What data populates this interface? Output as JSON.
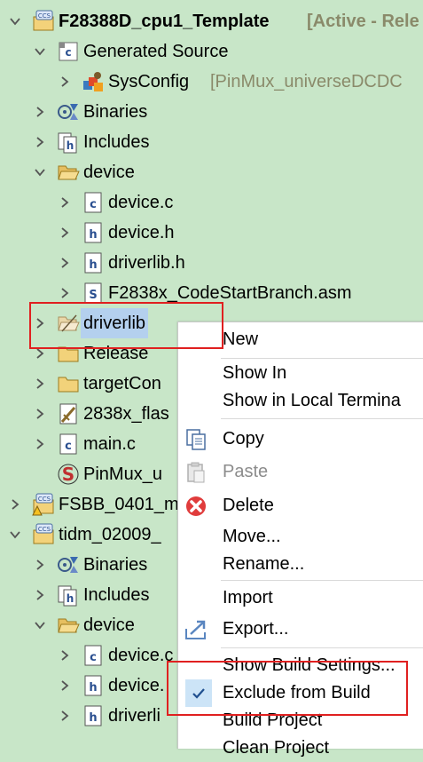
{
  "tree": [
    {
      "label": "F28388D_cpu1_Template",
      "deco": "[Active - Rele",
      "arrow": "down",
      "icon": "ccs-project-icon",
      "bold": true
    },
    {
      "label": "Generated Source",
      "arrow": "down",
      "icon": "source-folder-icon"
    },
    {
      "label": "SysConfig",
      "deco": "[PinMux_universeDCDC",
      "arrow": "right",
      "icon": "sysconfig-icon"
    },
    {
      "label": "Binaries",
      "arrow": "right",
      "icon": "binaries-icon"
    },
    {
      "label": "Includes",
      "arrow": "right",
      "icon": "includes-icon"
    },
    {
      "label": "device",
      "arrow": "down",
      "icon": "folder-open-icon"
    },
    {
      "label": "device.c",
      "arrow": "right",
      "icon": "c-file-icon"
    },
    {
      "label": "device.h",
      "arrow": "right",
      "icon": "h-file-icon"
    },
    {
      "label": "driverlib.h",
      "arrow": "right",
      "icon": "h-file-icon"
    },
    {
      "label": "F2838x_CodeStartBranch.asm",
      "arrow": "right",
      "icon": "asm-file-icon"
    },
    {
      "label": "driverlib",
      "arrow": "right",
      "icon": "excluded-folder-icon"
    },
    {
      "label": "Release",
      "arrow": "right",
      "icon": "folder-icon"
    },
    {
      "label": "targetCon",
      "arrow": "right",
      "icon": "folder-icon"
    },
    {
      "label": "2838x_flas",
      "arrow": "right",
      "icon": "cmd-file-icon"
    },
    {
      "label": "main.c",
      "arrow": "right",
      "icon": "c-file-icon"
    },
    {
      "label": "PinMux_u",
      "arrow": "none",
      "icon": "syscfg-file-icon"
    },
    {
      "label": "FSBB_0401_m",
      "arrow": "right",
      "icon": "ccs-project-warn-icon"
    },
    {
      "label": "tidm_02009_",
      "arrow": "down",
      "icon": "ccs-project-icon"
    },
    {
      "label": "Binaries",
      "arrow": "right",
      "icon": "binaries-icon"
    },
    {
      "label": "Includes",
      "arrow": "right",
      "icon": "includes-icon"
    },
    {
      "label": "device",
      "arrow": "down",
      "icon": "folder-open-icon"
    },
    {
      "label": "device.c",
      "arrow": "right",
      "icon": "c-file-icon"
    },
    {
      "label": "device.",
      "arrow": "right",
      "icon": "h-file-icon"
    },
    {
      "label": "driverli",
      "arrow": "right",
      "icon": "h-file-icon"
    }
  ],
  "menu": {
    "new": "New",
    "show_in": "Show In",
    "show_in_terminal": "Show in Local Termina",
    "copy": "Copy",
    "paste": "Paste",
    "delete": "Delete",
    "move": "Move...",
    "rename": "Rename...",
    "import": "Import",
    "export": "Export...",
    "show_build_settings": "Show Build Settings...",
    "exclude_from_build": "Exclude from Build",
    "build_project": "Build Project",
    "clean_project": "Clean Project"
  },
  "colors": {
    "background": "#c8e6c8",
    "highlight": "#e02020",
    "selection": "#cce4f7"
  }
}
